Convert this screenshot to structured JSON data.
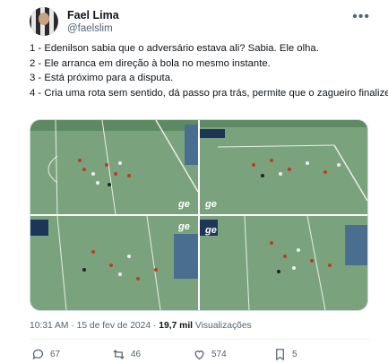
{
  "author": {
    "name": "Fael Lima",
    "handle": "@faelslim"
  },
  "tweet": {
    "lines": [
      "1 - Edenilson sabia que o adversário estava ali? Sabia. Ele olha.",
      "2 - Ele arranca em direção à bola no mesmo instante.",
      "3 - Está próximo para a disputa.",
      "4 - Cria uma rota sem sentido, dá passo pra trás, permite que o zagueiro finalize."
    ]
  },
  "media": {
    "watermark": "ge",
    "pitch_color": "#6e9a73"
  },
  "meta": {
    "time_date": "10:31 AM · 15 de fev de 2024 · ",
    "views_count": "19,7 mil",
    "views_label": "Visualizações"
  },
  "actions": {
    "replies": "67",
    "reposts": "46",
    "likes": "574",
    "bookmarks": "5"
  },
  "icons": [
    "more-options-icon",
    "reply-icon",
    "repost-icon",
    "like-icon",
    "bookmark-icon"
  ]
}
